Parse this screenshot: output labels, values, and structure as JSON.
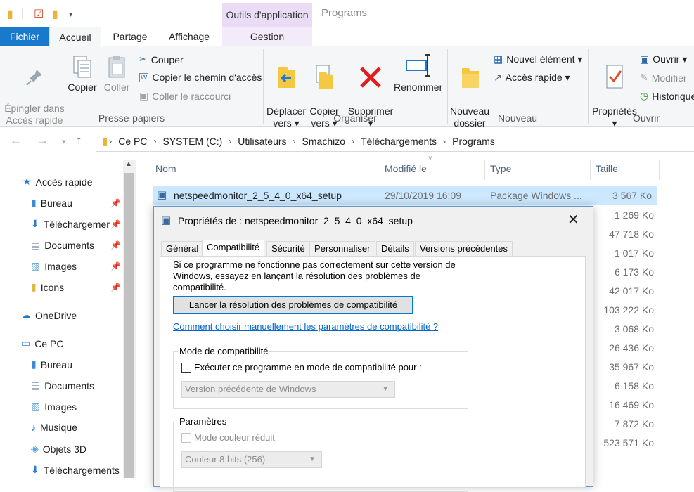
{
  "window": {
    "context_tab": "Outils d'application",
    "title": "Programs"
  },
  "tabs": {
    "fichier": "Fichier",
    "accueil": "Accueil",
    "partage": "Partage",
    "affichage": "Affichage",
    "gestion": "Gestion"
  },
  "ribbon": {
    "pin_label": "Épingler dans\nAccès rapide",
    "copy_label": "Copier",
    "paste_label": "Coller",
    "cut_label": "Couper",
    "copy_path_label": "Copier le chemin d'accès",
    "paste_shortcut_label": "Coller le raccourci",
    "group_clipboard": "Presse-papiers",
    "move_label": "Déplacer\nvers ▾",
    "copyto_label": "Copier\nvers ▾",
    "delete_label": "Supprimer\n▾",
    "rename_label": "Renommer",
    "group_organize": "Organiser",
    "new_folder_label": "Nouveau\ndossier",
    "new_item_label": "Nouvel élément ▾",
    "quick_access_label": "Accès rapide ▾",
    "group_new": "Nouveau",
    "properties_label": "Propriétés\n▾",
    "open_label": "Ouvrir ▾",
    "modify_label": "Modifier",
    "history_label": "Historique",
    "group_open": "Ouvrir"
  },
  "address": {
    "crumbs": [
      "Ce PC",
      "SYSTEM (C:)",
      "Utilisateurs",
      "Smachizo",
      "Téléchargements",
      "Programs"
    ]
  },
  "navpane": {
    "quick_access": "Accès rapide",
    "quick_items": [
      "Bureau",
      "Téléchargements",
      "Documents",
      "Images",
      "Icons"
    ],
    "onedrive": "OneDrive",
    "this_pc": "Ce PC",
    "pc_items": [
      "Bureau",
      "Documents",
      "Images",
      "Musique",
      "Objets 3D",
      "Téléchargements"
    ]
  },
  "filelist": {
    "col_name": "Nom",
    "col_modified": "Modifié le",
    "col_type": "Type",
    "col_size": "Taille",
    "selected_name": "netspeedmonitor_2_5_4_0_x64_setup",
    "selected_date": "29/10/2019 16:09",
    "selected_type": "Package Windows ...",
    "sizes": [
      "3 567 Ko",
      "1 269 Ko",
      "47 718 Ko",
      "1 017 Ko",
      "6 173 Ko",
      "42 017 Ko",
      "103 222 Ko",
      "3 068 Ko",
      "26 436 Ko",
      "35 967 Ko",
      "6 158 Ko",
      "16 469 Ko",
      "7 872 Ko",
      "523 571 Ko"
    ]
  },
  "dialog": {
    "title": "Propriétés de : netspeedmonitor_2_5_4_0_x64_setup",
    "tabs": [
      "Général",
      "Compatibilité",
      "Sécurité",
      "Personnaliser",
      "Détails",
      "Versions précédentes"
    ],
    "intro_line1": "Si ce programme ne fonctionne pas correctement sur cette version de",
    "intro_line2": "Windows, essayez en lançant la résolution des problèmes de",
    "intro_line3": "compatibilité.",
    "troubleshoot_button": "Lancer la résolution des problèmes de compatibilité",
    "manual_link": "Comment choisir manuellement les paramètres de compatibilité ?",
    "compat_group": "Mode de compatibilité",
    "compat_checkbox": "Exécuter ce programme en mode de compatibilité pour :",
    "compat_select": "Version précédente de Windows",
    "params_group": "Paramètres",
    "reduced_color": "Mode couleur réduit",
    "color_select": "Couleur 8 bits (256)"
  }
}
